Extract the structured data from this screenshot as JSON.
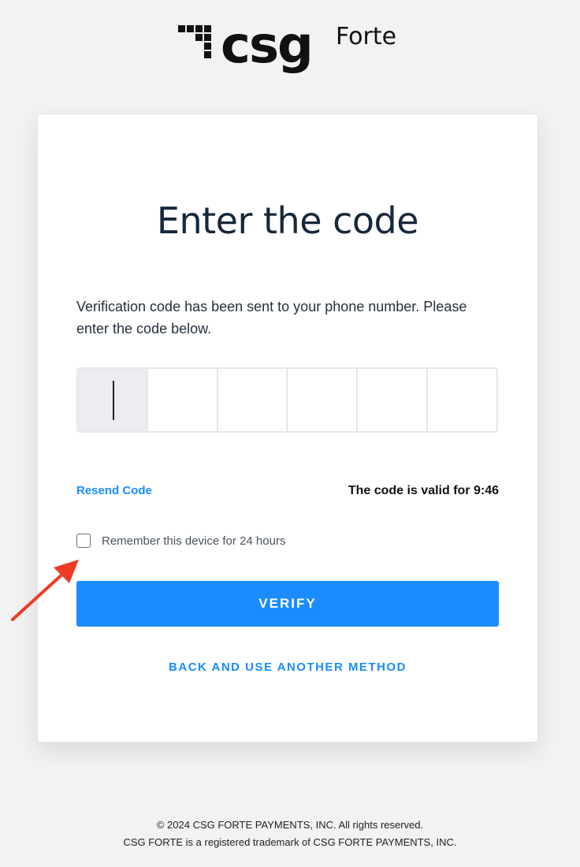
{
  "brand": {
    "logo_wordmark": "csg",
    "logo_product": "Forte"
  },
  "card": {
    "title": "Enter the code",
    "instructions": "Verification code has been sent to your phone number. Please enter the code below.",
    "code_digits": [
      "",
      "",
      "",
      "",
      "",
      ""
    ],
    "resend_label": "Resend Code",
    "validity_text": "The code is valid for 9:46",
    "remember_label": "Remember this device for 24 hours",
    "remember_checked": false,
    "verify_label": "VERIFY",
    "back_label": "BACK AND USE ANOTHER METHOD"
  },
  "footer": {
    "copyright": "© 2024 CSG FORTE PAYMENTS, INC. All rights reserved.",
    "trademark": "CSG FORTE is a registered trademark of CSG FORTE PAYMENTS, INC."
  },
  "colors": {
    "accent": "#1a8cff",
    "annotation_arrow": "#ee3b24"
  }
}
